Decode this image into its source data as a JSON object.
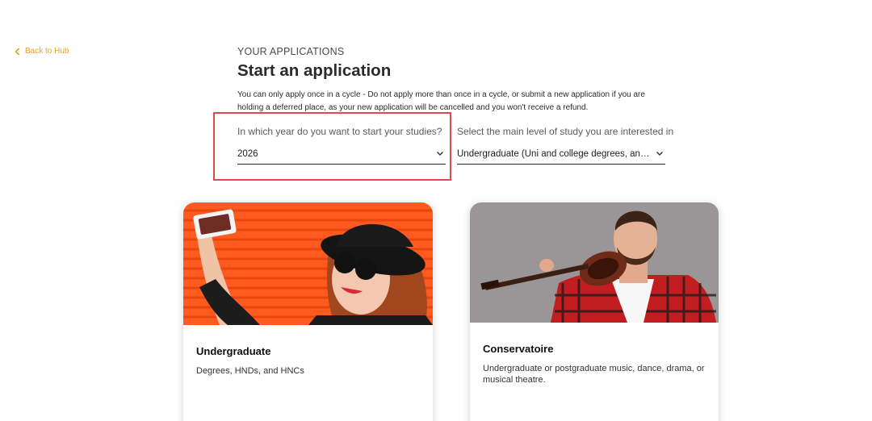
{
  "nav": {
    "back_label": "Back to Hub"
  },
  "header": {
    "eyebrow": "YOUR APPLICATIONS",
    "title": "Start an application",
    "description": "You can only apply once in a cycle - Do not apply more than once in a cycle, or submit a new application if you are holding a deferred place, as your new application will be cancelled and you won't receive a refund."
  },
  "form": {
    "year": {
      "label": "In which year do you want to start your studies?",
      "value": "2026"
    },
    "level": {
      "label": "Select the main level of study you are interested in",
      "value": "Undergraduate (Uni and college degrees, and apprenticeships)"
    }
  },
  "cards": [
    {
      "title": "Undergraduate",
      "text": "Degrees, HNDs, and HNCs"
    },
    {
      "title": "Conservatoire",
      "text": "Undergraduate or postgraduate music, dance, drama, or musical theatre."
    }
  ],
  "colors": {
    "accent": "#e8a21b",
    "highlight": "#e04a4a"
  }
}
